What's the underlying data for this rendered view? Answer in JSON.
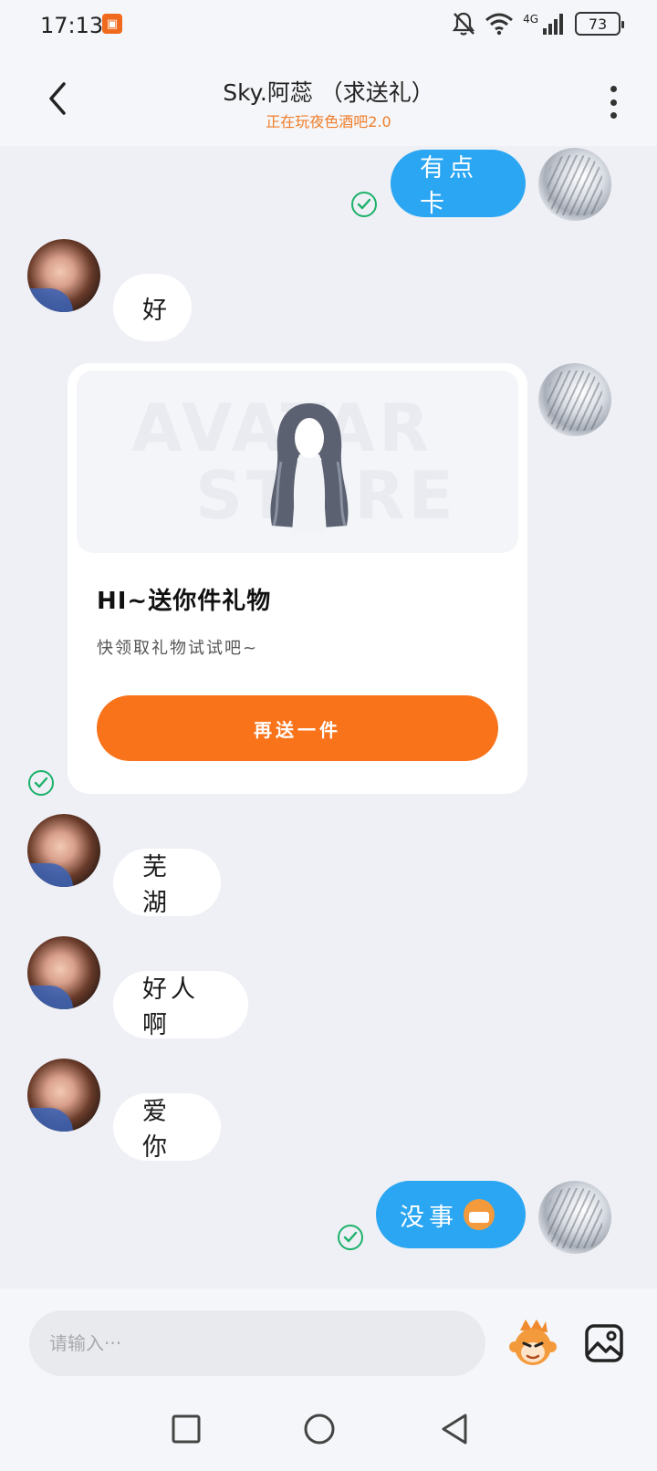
{
  "status_bar": {
    "time": "17:13",
    "network": "4G",
    "battery": "73",
    "icons": [
      "app-notification-icon",
      "bell-muted-icon",
      "wifi-icon",
      "signal-icon",
      "battery-icon"
    ]
  },
  "header": {
    "title": "Sky.阿蕊 （求送礼）",
    "subtitle": "正在玩夜色酒吧2.0"
  },
  "messages": [
    {
      "from": "self",
      "text": "有点卡",
      "read": true
    },
    {
      "from": "other",
      "text": "好"
    },
    {
      "from": "self",
      "type": "gift",
      "read": true
    },
    {
      "from": "other",
      "text": "芜湖"
    },
    {
      "from": "other",
      "text": "好人啊"
    },
    {
      "from": "other",
      "text": "爱你"
    },
    {
      "from": "self",
      "text": "没事",
      "emoji": "grin-face-icon",
      "read": true
    }
  ],
  "gift_card": {
    "watermark_line1": "AVATAR",
    "watermark_line2": "STORE",
    "title": "HI~送你件礼物",
    "description": "快领取礼物试试吧~",
    "button_label": "再送一件"
  },
  "input": {
    "placeholder": "请输入···"
  },
  "colors": {
    "outgoing_bubble": "#2ba6f2",
    "incoming_bubble": "#ffffff",
    "accent_orange": "#f9731b",
    "read_check": "#1db16a",
    "background": "#eef0f5"
  }
}
